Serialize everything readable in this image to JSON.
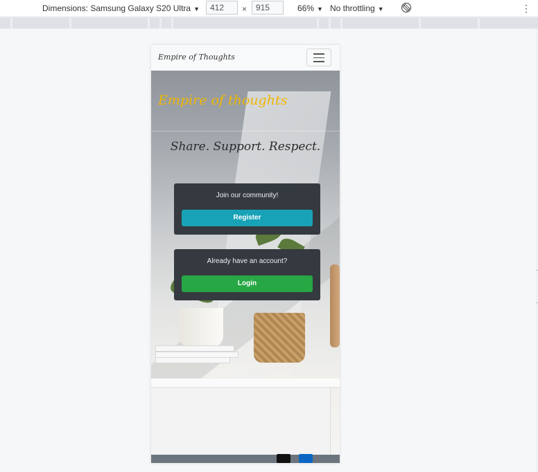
{
  "devtools": {
    "dimensions_label": "Dimensions: Samsung Galaxy S20 Ultra",
    "width": "412",
    "times": "×",
    "height": "915",
    "zoom": "66%",
    "throttling": "No throttling",
    "dropdown_arrow": "▼",
    "more_glyph": "⋮"
  },
  "navbar": {
    "brand": "Empire of Thoughts"
  },
  "hero": {
    "title": "Empire of thoughts",
    "tagline": "Share. Support. Respect."
  },
  "register_card": {
    "prompt": "Join our community!",
    "button": "Register"
  },
  "login_card": {
    "prompt": "Already have an account?",
    "button": "Login"
  },
  "colors": {
    "brand_yellow": "#f2b600",
    "card_dark": "#343a40",
    "register_teal": "#17a2b8",
    "login_green": "#28a745"
  },
  "icons": [
    "rotate-icon",
    "hamburger-icon",
    "twitter-icon",
    "linkedin-icon"
  ]
}
